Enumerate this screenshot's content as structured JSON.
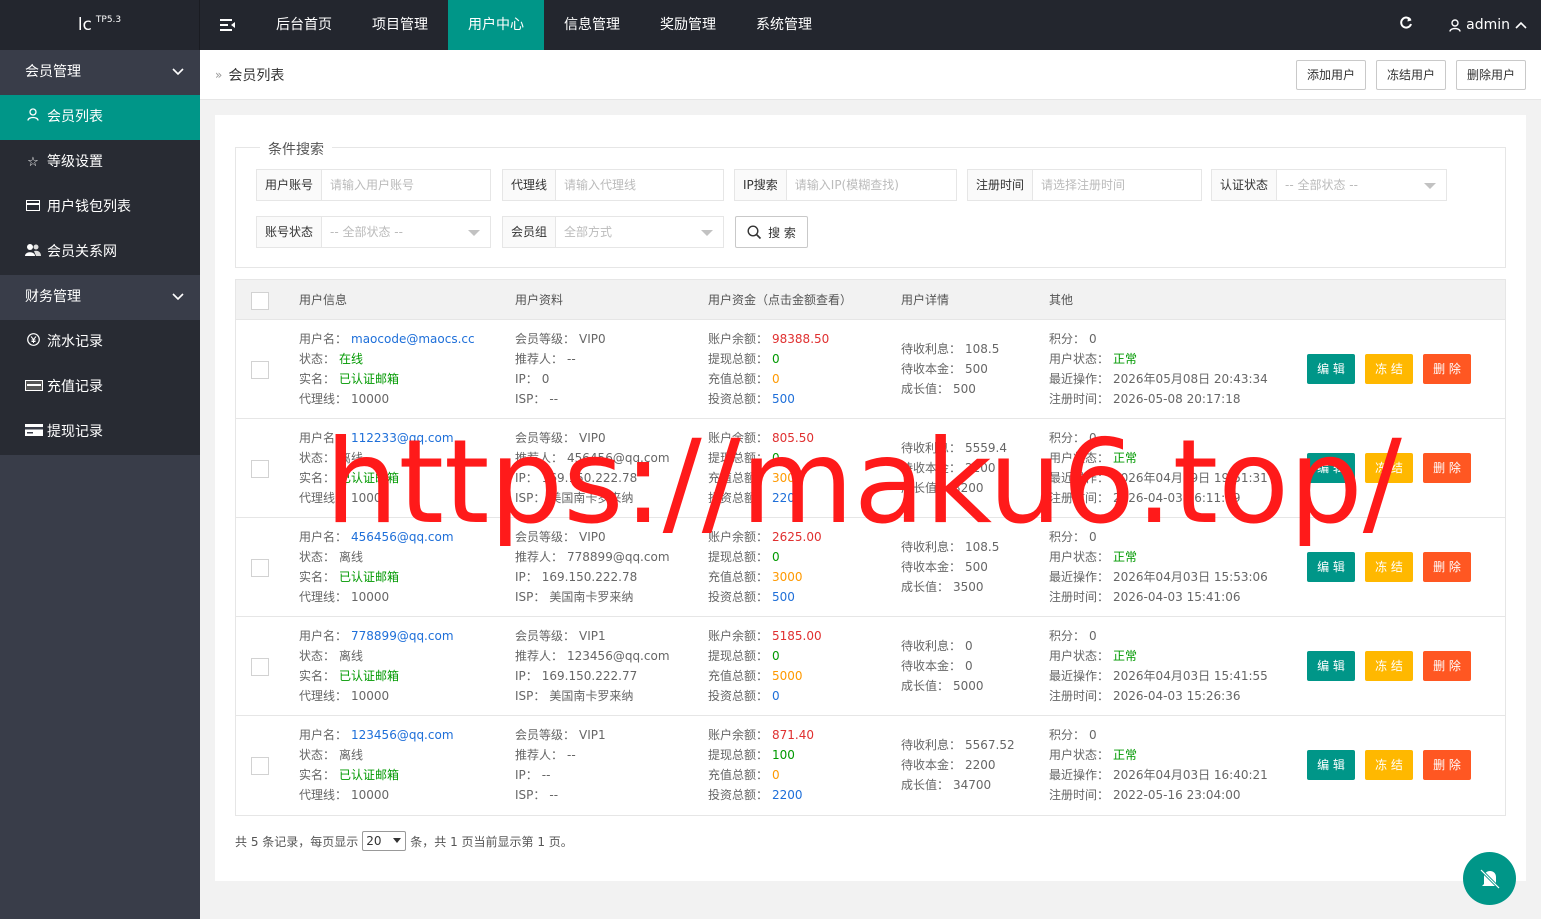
{
  "logo": {
    "text": "lc",
    "version": "TP5.3"
  },
  "nav": [
    "后台首页",
    "项目管理",
    "用户中心",
    "信息管理",
    "奖励管理",
    "系统管理"
  ],
  "nav_active": "用户中心",
  "user": {
    "name": "admin"
  },
  "sidebar": {
    "group1": "会员管理",
    "items1": [
      {
        "label": "会员列表",
        "icon": "user-icon",
        "active": true
      },
      {
        "label": "等级设置",
        "icon": "star-icon"
      },
      {
        "label": "用户钱包列表",
        "icon": "wallet-icon"
      },
      {
        "label": "会员关系网",
        "icon": "users-icon"
      }
    ],
    "group2": "财务管理",
    "items2": [
      {
        "label": "流水记录",
        "icon": "yen-icon"
      },
      {
        "label": "充值记录",
        "icon": "card-icon"
      },
      {
        "label": "提现记录",
        "icon": "bank-card-icon"
      }
    ]
  },
  "breadcrumb": "会员列表",
  "toolbar": {
    "add": "添加用户",
    "freeze": "冻结用户",
    "delete": "删除用户"
  },
  "search": {
    "legend": "条件搜索",
    "account_label": "用户账号",
    "account_placeholder": "请输入用户账号",
    "agent_label": "代理线",
    "agent_placeholder": "请输入代理线",
    "ip_label": "IP搜索",
    "ip_placeholder": "请输入IP(模糊查找)",
    "reg_label": "注册时间",
    "reg_placeholder": "请选择注册时间",
    "auth_label": "认证状态",
    "auth_value": "-- 全部状态 --",
    "status_label": "账号状态",
    "status_value": "-- 全部状态 --",
    "group_label": "会员组",
    "group_value": "全部方式",
    "button": "搜 索"
  },
  "table": {
    "headers": [
      "用户信息",
      "用户资料",
      "用户资金（点击金额查看）",
      "用户详情",
      "其他"
    ],
    "labels": {
      "username": "用户名：",
      "state": "状态：",
      "realname": "实名：",
      "agent": "代理线：",
      "level": "会员等级：",
      "referrer": "推荐人：",
      "ip": "IP：",
      "isp": "ISP：",
      "balance": "账户余额：",
      "withdraw": "提现总额：",
      "recharge": "充值总额：",
      "invest": "投资总额：",
      "interest": "待收利息：",
      "principal": "待收本金：",
      "growth": "成长值：",
      "points": "积分：",
      "ustatus": "用户状态：",
      "lastop": "最近操作：",
      "regtime": "注册时间："
    },
    "buttons": {
      "edit": "编 辑",
      "freeze": "冻 结",
      "delete": "删 除"
    },
    "rows": [
      {
        "username": "maocode@maocs.cc",
        "state": "在线",
        "realname": "已认证邮箱",
        "agent": "10000",
        "level": "VIP0",
        "referrer": "--",
        "ip": "0",
        "isp": "--",
        "balance": "98388.50",
        "withdraw": "0",
        "recharge": "0",
        "invest": "500",
        "interest": "108.5",
        "principal": "500",
        "growth": "500",
        "points": "0",
        "ustatus": "正常",
        "lastop": "2026年05月08日 20:43:34",
        "regtime": "2026-05-08 20:17:18"
      },
      {
        "username": "112233@qq.com",
        "state": "离线",
        "realname": "已认证邮箱",
        "agent": "10000",
        "level": "VIP0",
        "referrer": "456456@qq.com",
        "ip": "169.150.222.78",
        "isp": "美国南卡罗来纳",
        "balance": "805.50",
        "withdraw": "0",
        "recharge": "3000",
        "invest": "2200",
        "interest": "5559.4",
        "principal": "2200",
        "growth": "3200",
        "points": "0",
        "ustatus": "正常",
        "lastop": "2026年04月29日 19:51:31",
        "regtime": "2026-04-03 16:11:19"
      },
      {
        "username": "456456@qq.com",
        "state": "离线",
        "realname": "已认证邮箱",
        "agent": "10000",
        "level": "VIP0",
        "referrer": "778899@qq.com",
        "ip": "169.150.222.78",
        "isp": "美国南卡罗来纳",
        "balance": "2625.00",
        "withdraw": "0",
        "recharge": "3000",
        "invest": "500",
        "interest": "108.5",
        "principal": "500",
        "growth": "3500",
        "points": "0",
        "ustatus": "正常",
        "lastop": "2026年04月03日 15:53:06",
        "regtime": "2026-04-03 15:41:06"
      },
      {
        "username": "778899@qq.com",
        "state": "离线",
        "realname": "已认证邮箱",
        "agent": "10000",
        "level": "VIP1",
        "referrer": "123456@qq.com",
        "ip": "169.150.222.77",
        "isp": "美国南卡罗来纳",
        "balance": "5185.00",
        "withdraw": "0",
        "recharge": "5000",
        "invest": "0",
        "interest": "0",
        "principal": "0",
        "growth": "5000",
        "points": "0",
        "ustatus": "正常",
        "lastop": "2026年04月03日 15:41:55",
        "regtime": "2026-04-03 15:26:36"
      },
      {
        "username": "123456@qq.com",
        "state": "离线",
        "realname": "已认证邮箱",
        "agent": "10000",
        "level": "VIP1",
        "referrer": "--",
        "ip": "--",
        "isp": "--",
        "balance": "871.40",
        "withdraw": "100",
        "recharge": "0",
        "invest": "2200",
        "interest": "5567.52",
        "principal": "2200",
        "growth": "34700",
        "points": "0",
        "ustatus": "正常",
        "lastop": "2026年04月03日 16:40:21",
        "regtime": "2022-05-16 23:04:00"
      }
    ]
  },
  "pager": {
    "prefix": "共 5 条记录，每页显示",
    "page_size": "20",
    "suffix": "条，共 1 页当前显示第 1 页。"
  },
  "watermark": "https://maku6.top/",
  "colors": {
    "primary": "#009688",
    "warn": "#ffb800",
    "danger": "#ff5722",
    "dark": "#23262e",
    "side": "#393d49"
  }
}
